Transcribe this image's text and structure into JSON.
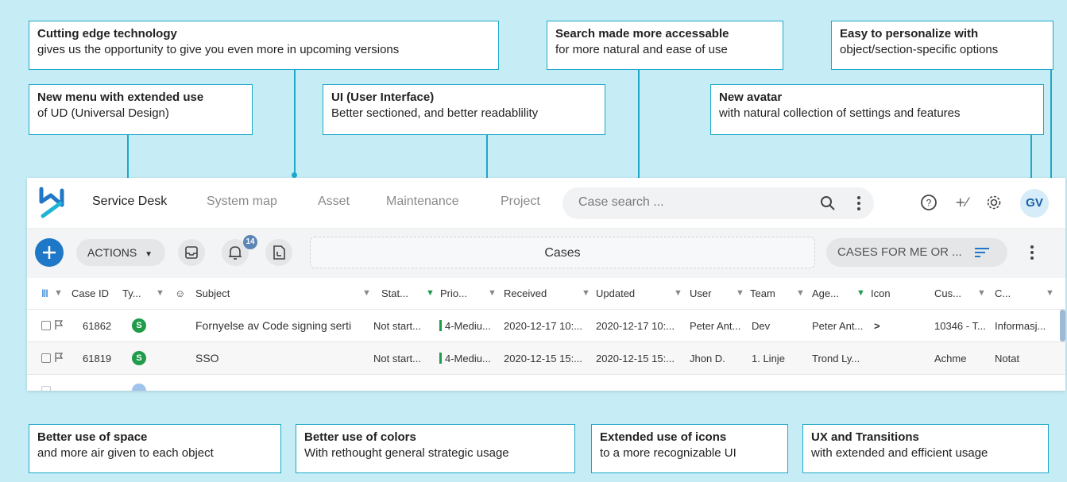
{
  "callouts": {
    "tech": {
      "title": "Cutting edge technology",
      "desc": "gives us the opportunity to give you even more in upcoming versions"
    },
    "search": {
      "title": "Search made more accessable",
      "desc": "for more natural and ease of use"
    },
    "personalize": {
      "title": "Easy to personalize with",
      "desc": "object/section-specific options"
    },
    "menu": {
      "title": "New menu with extended use",
      "desc": "of UD (Universal Design)"
    },
    "ui": {
      "title": "UI (User Interface)",
      "desc": "Better sectioned, and better readablility"
    },
    "avatar": {
      "title": "New avatar",
      "desc": "with natural collection of settings and features"
    },
    "space": {
      "title": "Better use of space",
      "desc": "and more air given to each object"
    },
    "colors": {
      "title": "Better use of colors",
      "desc": "With rethought general strategic usage"
    },
    "icons": {
      "title": "Extended use of icons",
      "desc": "to a more recognizable UI"
    },
    "ux": {
      "title": "UX and Transitions",
      "desc": "with extended and efficient usage"
    }
  },
  "colors": {
    "accent": "#1fa7c9",
    "background": "#c6edf6",
    "primary": "#1f78c7",
    "status_green": "#1f9b4a"
  },
  "topbar": {
    "nav": [
      "Service Desk",
      "System map",
      "Asset",
      "Maintenance",
      "Project"
    ],
    "active_nav": "Service Desk",
    "search_placeholder": "Case search ...",
    "avatar_initials": "GV",
    "icons": [
      "logo",
      "search-icon",
      "kebab-icon",
      "help-icon",
      "shortcut-icon",
      "gear-icon"
    ]
  },
  "toolbar": {
    "actions_label": "ACTIONS",
    "notification_count": "14",
    "title": "Cases",
    "filter_label": "CASES FOR ME OR ..."
  },
  "table": {
    "columns": [
      "Case ID",
      "Ty...",
      "Subject",
      "Stat...",
      "Prio...",
      "Received",
      "Updated",
      "User",
      "Team",
      "Age...",
      "Icon",
      "Cus...",
      "C..."
    ],
    "rows": [
      {
        "id": "61862",
        "type": "S",
        "subject": "Fornyelse av Code signing serti",
        "status": "Not start...",
        "prio": "4-Mediu...",
        "received": "2020-12-17 10:...",
        "updated": "2020-12-17 10:...",
        "user": "Peter Ant...",
        "team": "Dev",
        "agent": "Peter Ant...",
        "icon": ">",
        "customer": "10346 - T...",
        "category": "Informasj..."
      },
      {
        "id": "61819",
        "type": "S",
        "subject": "SSO",
        "status": "Not start...",
        "prio": "4-Mediu...",
        "received": "2020-12-15 15:...",
        "updated": "2020-12-15 15:...",
        "user": "Jhon D.",
        "team": "1. Linje",
        "agent": "Trond Ly...",
        "icon": "",
        "customer": "Achme",
        "category": "Notat"
      }
    ]
  }
}
